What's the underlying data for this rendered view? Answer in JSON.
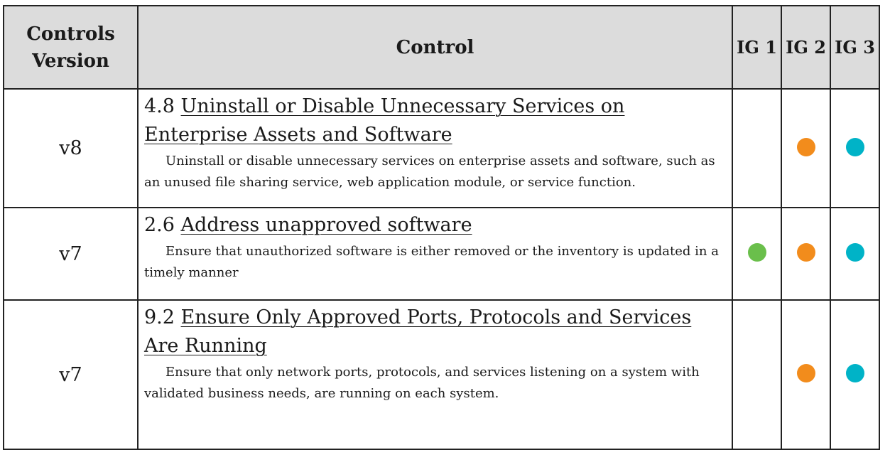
{
  "header": {
    "version_label": "Controls Version",
    "control_label": "Control",
    "ig1_label": "IG 1",
    "ig2_label": "IG 2",
    "ig3_label": "IG 3"
  },
  "colors": {
    "ig1": "#6abf4b",
    "ig2": "#f28c1c",
    "ig3": "#00b3c7",
    "header_bg": "#dcdcdc"
  },
  "rows": [
    {
      "version": "v8",
      "number": "4.8",
      "title": "Uninstall or Disable Unnecessary Services on Enterprise Assets and Software",
      "description": "Uninstall or disable unnecessary services on enterprise assets and software, such as an unused file sharing service, web application module, or service function.",
      "ig1": false,
      "ig2": true,
      "ig3": true
    },
    {
      "version": "v7",
      "number": "2.6",
      "title": "Address unapproved software",
      "description": "Ensure that unauthorized software is either removed or the inventory is updated in a timely manner",
      "ig1": true,
      "ig2": true,
      "ig3": true
    },
    {
      "version": "v7",
      "number": "9.2",
      "title": "Ensure Only Approved Ports, Protocols and Services Are Running",
      "description": "Ensure that only network ports, protocols, and services listening on a system with validated business needs, are running on each system.",
      "ig1": false,
      "ig2": true,
      "ig3": true
    }
  ]
}
